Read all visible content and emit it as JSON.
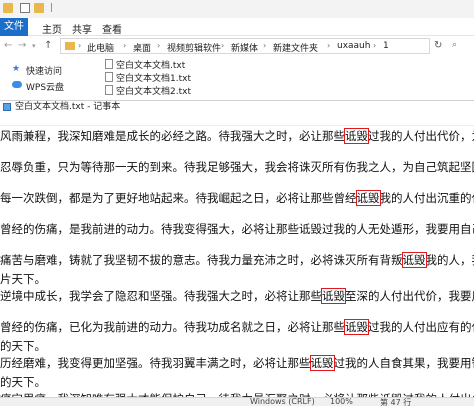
{
  "explorer": {
    "title": "文件",
    "ribbon": {
      "file": "文件",
      "home": "主页",
      "share": "共享",
      "view": "查看"
    },
    "breadcrumb": [
      "此电脑",
      "桌面",
      "视频剪辑软件",
      "新媒体",
      "新建文件夹",
      "uxaauh",
      "1"
    ],
    "nav": [
      {
        "label": "快速访问",
        "icon": "star-icon"
      },
      {
        "label": "WPS云盘",
        "icon": "cloud-icon"
      }
    ],
    "files": [
      "空白文本文档.txt",
      "空白文本文档1.txt",
      "空白文本文档2.txt"
    ]
  },
  "notepad": {
    "title": "空白文本文档.txt - 记事本",
    "lines": [
      {
        "pre": "风雨兼程，我深知磨难是成长的必经之路。待我强大之时，必让那些",
        "hl": "诋毁",
        "post": "过我的人付出代价，为自己赢得一片天地"
      },
      {
        "pre": "忍辱负重，只为等待那一天的到来。待我足够强大，我会将诛灭所有伤我之人，为自己筑起坚固的城池。",
        "hl": "",
        "post": ""
      },
      {
        "pre": "每一次跌倒，都是为了更好地站起来。待我崛起之日，必将让那些曾经",
        "hl": "诋毁",
        "post": "我的人付出沉重的代价，我要让天下人"
      },
      {
        "pre": "曾经的伤痛，是我前进的动力。待我变得强大，必将让那些诋毁过我的人无处遁形，我要用自己的双手开创一个新",
        "hl": "",
        "post": ""
      },
      {
        "pre": "痛苦与磨难，铸就了我坚韧不拔的意志。待我力量充沛之时，必将诛灭所有背叛",
        "hl": "诋毁",
        "post": "我的人，我要给自己创造一",
        "cont": "片天下。"
      },
      {
        "pre": "逆境中成长，我学会了隐忍和坚强。待我强大之时，必将让那些",
        "hl": "诋毁",
        "post": "至深的人付出代价，我要用实力赢得属于我",
        "cont": ""
      },
      {
        "pre": "曾经的伤痛，已化为我前进的动力。待我功成名就之日，必将让那些",
        "hl": "诋毁",
        "post": "过我的人付出应有的代价，我要让天下人",
        "cont": "的天下。"
      },
      {
        "pre": "历经磨难，我变得更加坚强。待我羽翼丰满之时，必将让那些",
        "hl": "诋毁",
        "post": "过我的人自食其果，我要用智慧和力量为自己开",
        "cont": "的天下。"
      },
      {
        "pre": "痛定思痛，我深知唯有强大才能保护自己。待我力量汇聚之时，必将让那些诋毁过我的人付出代价，我要在天下",
        "hl": "",
        "post": ""
      }
    ],
    "status": {
      "encoding": "Windows (CRLF)",
      "zoom": "100%",
      "position": "第 47 行"
    }
  },
  "colors": {
    "highlight": "#e0191e",
    "ribbon_file": "#1c6fc8"
  }
}
